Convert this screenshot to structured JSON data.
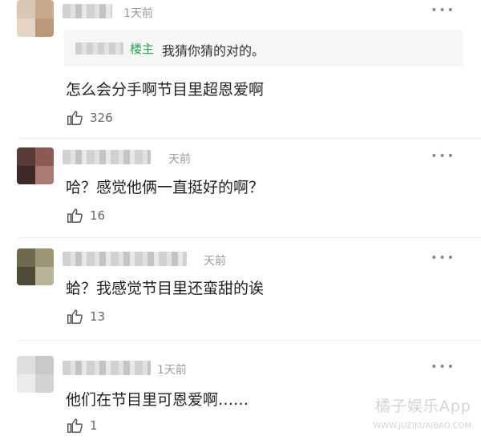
{
  "comments": [
    {
      "time": "1天前",
      "more": "•••",
      "reply": {
        "badge": "楼主",
        "text": "我猜你猜的对的。"
      },
      "content": "怎么会分手啊节目里超恩爱啊",
      "likes": "326",
      "avatar_colors": [
        "#d9c7b3",
        "#c7a98c",
        "#e3d4c4",
        "#b89a7a"
      ]
    },
    {
      "time": "天前",
      "more": "•••",
      "content": "哈？感觉他俩一直挺好的啊？",
      "likes": "16",
      "avatar_colors": [
        "#5a3a36",
        "#8b5a52",
        "#3d2a28",
        "#a97c73"
      ]
    },
    {
      "time": "天前",
      "more": "•••",
      "content": "蛤？我感觉节目里还蛮甜的诶",
      "likes": "13",
      "avatar_colors": [
        "#6f6a4f",
        "#9c9674",
        "#4d4a38",
        "#b9b39a"
      ]
    },
    {
      "time": "1天前",
      "more": "•••",
      "content": "他们在节目里可恩爱啊……",
      "likes": "1",
      "avatar_colors": [
        "#dedede",
        "#c9c9c9",
        "#ebebeb",
        "#d3d3d3"
      ]
    }
  ],
  "watermark": {
    "brand": "橘子娱乐App",
    "url": "WWW.JUZIKUAIBAO.COM"
  }
}
